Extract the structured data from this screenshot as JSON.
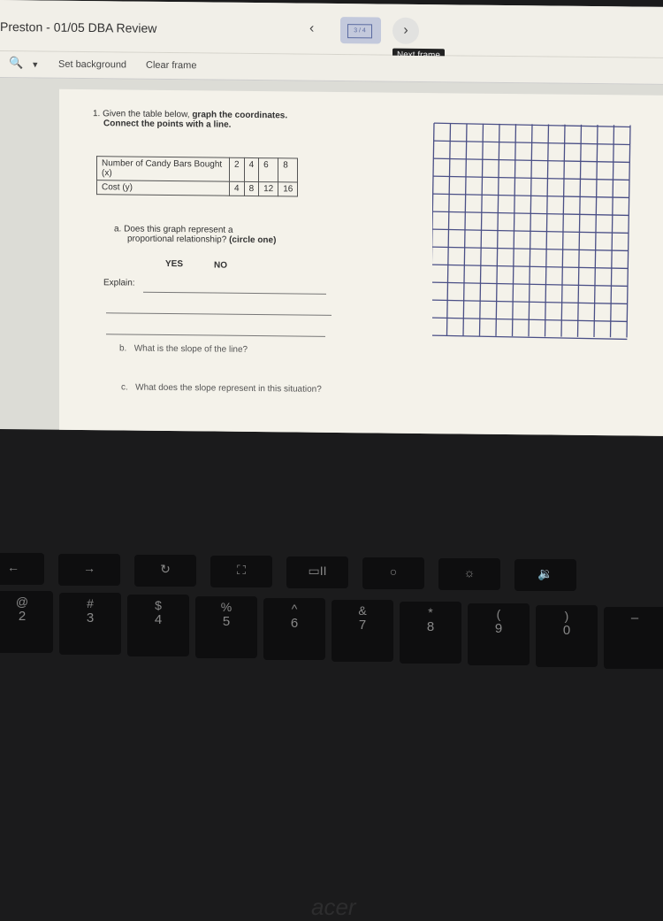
{
  "window": {
    "title": "Preston - 01/05 DBA Review",
    "frame_counter": "3 / 4",
    "prev_icon": "chevron-left",
    "next_icon": "chevron-right",
    "tooltip": "Next frame"
  },
  "toolbar": {
    "zoom_icon": "zoom-in",
    "dropdown": "▾",
    "set_background": "Set background",
    "clear_frame": "Clear frame"
  },
  "worksheet": {
    "q1_number": "1.",
    "q1_normal": "Given the table below,",
    "q1_bold": "graph the coordinates.",
    "q1_line2": "Connect the points with a line.",
    "table": {
      "row1_label": "Number of Candy Bars Bought (x)",
      "row1_values": [
        "2",
        "4",
        "6",
        "8"
      ],
      "row2_label": "Cost (y)",
      "row2_values": [
        "4",
        "8",
        "12",
        "16"
      ]
    },
    "qa_letter": "a.",
    "qa_line1": "Does this graph represent a",
    "qa_line2": "proportional relationship?",
    "qa_bold": "(circle one)",
    "yes": "YES",
    "no": "NO",
    "explain": "Explain:",
    "qb_letter": "b.",
    "qb": "What is the slope of the line?",
    "qc_letter": "c.",
    "qc": "What does the slope represent in this situation?",
    "grid": {
      "columns": 12,
      "rows": 12,
      "color": "#4a4f86"
    }
  },
  "keyboard": {
    "logo": "acer",
    "top_row": [
      "←",
      "→",
      "↻",
      "⛶",
      "▭II",
      "○",
      "☼",
      "🔉"
    ],
    "number_row": [
      [
        "@",
        "2"
      ],
      [
        "#",
        "3"
      ],
      [
        "$",
        "4"
      ],
      [
        "%",
        "5"
      ],
      [
        "^",
        "6"
      ],
      [
        "&",
        "7"
      ],
      [
        "*",
        "8"
      ],
      [
        "(",
        "9"
      ],
      [
        ")",
        "0"
      ],
      [
        "",
        "–"
      ]
    ]
  }
}
